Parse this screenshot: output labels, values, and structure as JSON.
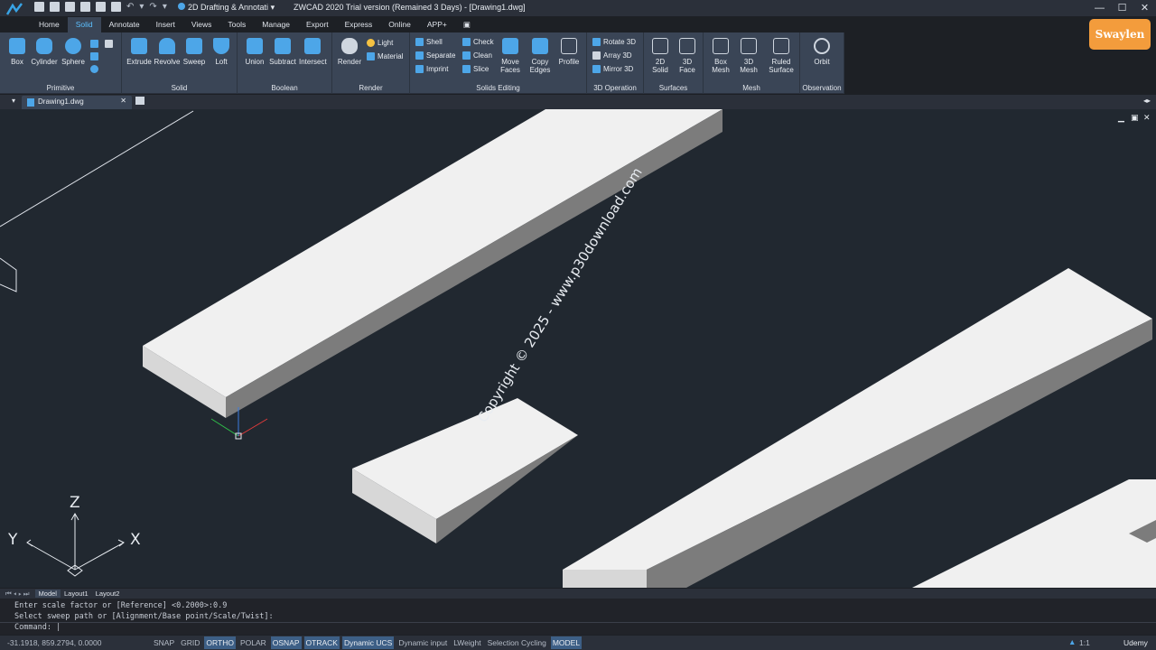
{
  "app": {
    "workspace": "2D Drafting & Annotati",
    "title": "ZWCAD 2020 Trial version (Remained 3 Days) - [Drawing1.dwg]",
    "brand": "Swaylen"
  },
  "tabs": [
    "Home",
    "Solid",
    "Annotate",
    "Insert",
    "Views",
    "Tools",
    "Manage",
    "Export",
    "Express",
    "Online",
    "APP+"
  ],
  "active_tab": "Solid",
  "ribbon": {
    "primitive": {
      "title": "Primitive",
      "tools": [
        "Box",
        "Cylinder",
        "Sphere"
      ]
    },
    "solid": {
      "title": "Solid",
      "tools": [
        "Extrude",
        "Revolve",
        "Sweep",
        "Loft"
      ]
    },
    "boolean": {
      "title": "Boolean",
      "tools": [
        "Union",
        "Subtract",
        "Intersect"
      ]
    },
    "render": {
      "title": "Render",
      "tools": [
        "Render"
      ],
      "small": [
        "Light",
        "Material"
      ]
    },
    "solids_editing": {
      "title": "Solids Editing",
      "small_col1": [
        "Shell",
        "Separate",
        "Imprint"
      ],
      "small_col2": [
        "Check",
        "Clean",
        "Slice"
      ],
      "tools": [
        "Move Faces",
        "Copy Edges",
        "Profile"
      ]
    },
    "op3d": {
      "title": "3D Operation",
      "small": [
        "Rotate 3D",
        "Array 3D",
        "Mirror 3D"
      ]
    },
    "surfaces": {
      "title": "Surfaces",
      "tools": [
        "2D Solid",
        "3D Face"
      ]
    },
    "mesh": {
      "title": "Mesh",
      "tools": [
        "Box Mesh",
        "3D Mesh",
        "Ruled Surface"
      ]
    },
    "observation": {
      "title": "Observation",
      "tools": [
        "Orbit"
      ]
    }
  },
  "document_tab": "Drawing1.dwg",
  "layout_tabs": [
    "Model",
    "Layout1",
    "Layout2"
  ],
  "watermark": "Copyright © 2025 - www.p30download.com",
  "axes": {
    "z": "Z",
    "y": "Y",
    "x": "X"
  },
  "command_lines": [
    "Enter scale factor or [Reference] <0.2000>:0.9",
    "Select sweep path or [Alignment/Base point/Scale/Twist]:"
  ],
  "command_prompt": "Command:",
  "status": {
    "coords": "-31.1918, 859.2794, 0.0000",
    "toggles": [
      {
        "label": "SNAP",
        "on": false
      },
      {
        "label": "GRID",
        "on": false
      },
      {
        "label": "ORTHO",
        "on": true
      },
      {
        "label": "POLAR",
        "on": false
      },
      {
        "label": "OSNAP",
        "on": true
      },
      {
        "label": "OTRACK",
        "on": true
      },
      {
        "label": "Dynamic UCS",
        "on": true
      },
      {
        "label": "Dynamic input",
        "on": false
      },
      {
        "label": "LWeight",
        "on": false
      },
      {
        "label": "Selection Cycling",
        "on": false
      },
      {
        "label": "MODEL",
        "on": true
      }
    ],
    "scale": "1:1",
    "udemy": "Udemy"
  },
  "colors": {
    "accent": "#5cc0ff",
    "ribbon": "#3a4556",
    "canvas": "#212830"
  }
}
